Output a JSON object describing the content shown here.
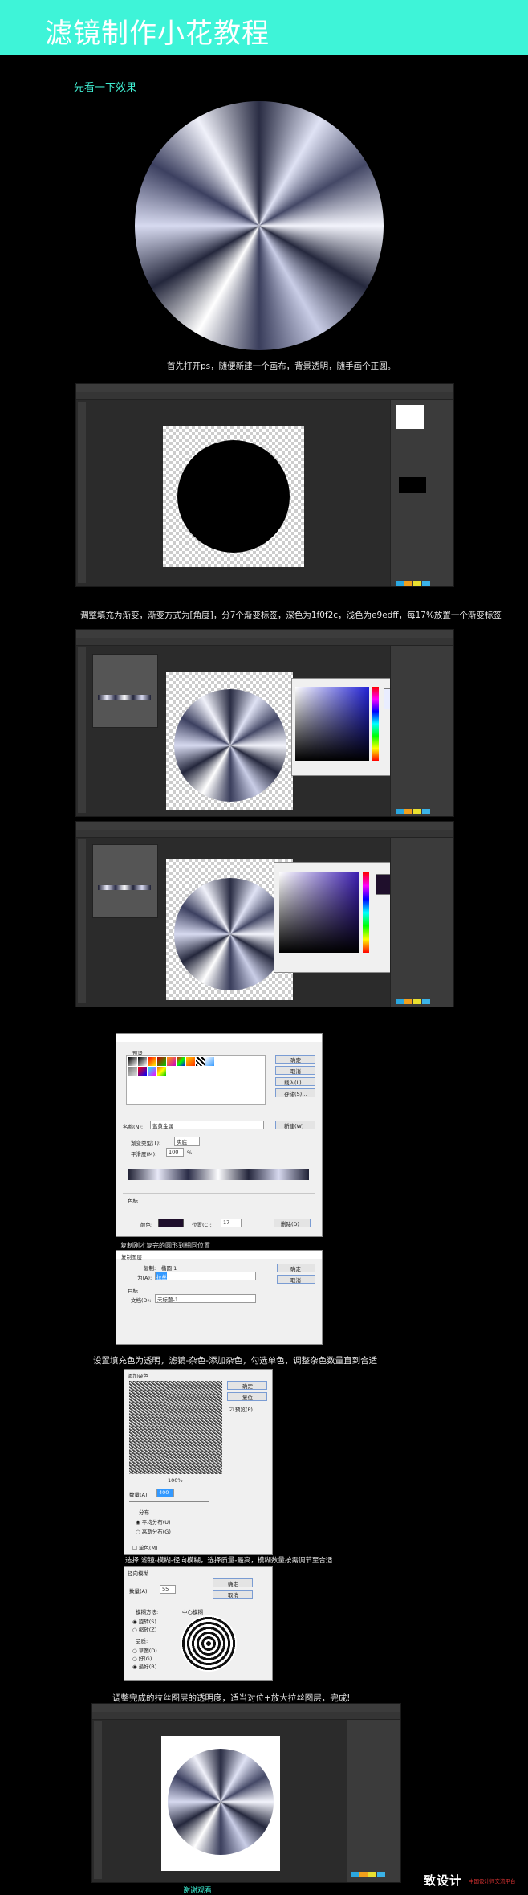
{
  "header": {
    "title": "滤镜制作小花教程"
  },
  "intro": {
    "preview_label": "先看一下效果"
  },
  "steps": [
    "首先打开ps，随便新建一个画布，背景透明，随手画个正圆。",
    "调整填充为渐变，渐变方式为[角度]，分7个渐变标签，深色为1f0f2c，浅色为e9edff，每17%放置一个渐变标签",
    "设置填充色为透明，滤镜-杂色-添加杂色，勾选单色，调整杂色数量直到合适",
    "选择 滤镜-模糊-径向模糊，选择质量-最高，模糊数量按需调节至合适",
    "调整完成的拉丝图层的透明度，适当对位+放大拉丝图层，完成!"
  ],
  "gradient_dialog": {
    "presets_label": "预设",
    "name_label": "名称(N):",
    "name_value": "蓝黄金属",
    "new_button": "新建(W)",
    "type_label": "渐变类型(T):",
    "type_value": "实底",
    "smooth_label": "平滑度(M):",
    "smooth_value": "100",
    "smooth_unit": "%",
    "stop_section": "色标",
    "color_label": "颜色:",
    "location_label": "位置(C):",
    "location_value": "17",
    "delete_button": "删除(D)",
    "ok": "确定",
    "cancel": "取消",
    "load": "载入(L)...",
    "save": "存储(S)...",
    "caption": "复制刚才复完的圆形到相同位置"
  },
  "duplicate_dialog": {
    "title": "复制图层",
    "layer_label": "复制:",
    "layer_value": "椭圆 1",
    "as_label": "为(A):",
    "as_value": "拉丝",
    "target_label": "目标",
    "doc_label": "文档(D):",
    "doc_value": "未标题-1",
    "ok": "确定",
    "cancel": "取消"
  },
  "noise_dialog": {
    "title": "添加杂色",
    "ok": "确定",
    "reset": "复位",
    "preview": "预览(P)",
    "zoom": "100%",
    "amount_label": "数量(A):",
    "amount_value": "400",
    "distribution_label": "分布",
    "uniform": "平均分布(U)",
    "gaussian": "高斯分布(G)",
    "mono": "单色(M)"
  },
  "blur_dialog": {
    "title": "径向模糊",
    "amount_label": "数量(A)",
    "amount_value": "55",
    "method_label": "模糊方法:",
    "spin": "旋转(S)",
    "zoom": "缩放(Z)",
    "quality_label": "品质:",
    "draft": "草图(D)",
    "good": "好(G)",
    "best": "最好(B)",
    "center_label": "中心模糊",
    "ok": "确定",
    "cancel": "取消"
  },
  "footer": {
    "thanks": "谢谢观看",
    "logo": "致设计",
    "logo_sub": "中国设计师交流平台"
  },
  "colors": {
    "accent": "#3ef4d8",
    "dark_stop": "#1f0f2c",
    "light_stop": "#e9edff"
  }
}
